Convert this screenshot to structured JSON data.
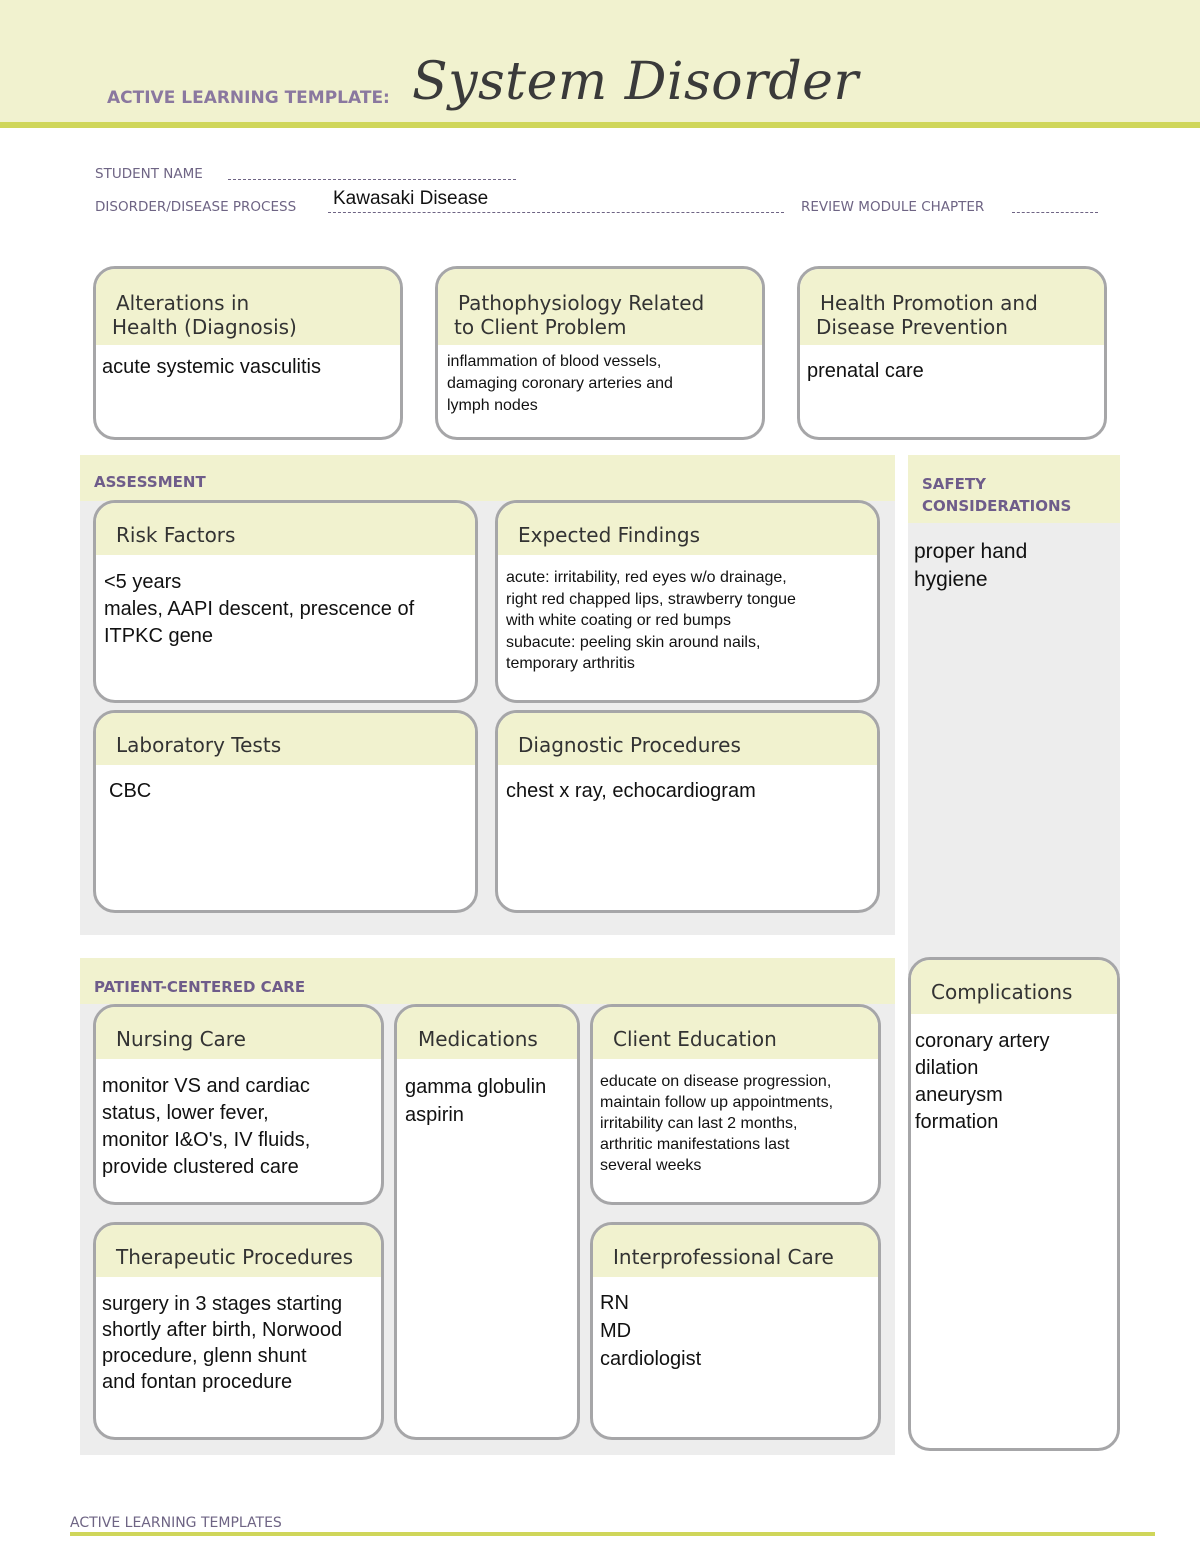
{
  "header": {
    "template_label": "ACTIVE LEARNING TEMPLATE:",
    "title": "System Disorder"
  },
  "meta": {
    "student_name_label": "STUDENT NAME",
    "student_name_value": "",
    "disorder_label": "DISORDER/DISEASE PROCESS",
    "disorder_value": "Kawasaki Disease",
    "review_module_label": "REVIEW MODULE CHAPTER",
    "review_module_value": ""
  },
  "top_cards": {
    "alterations": {
      "title_line1": "Alterations in",
      "title_line2": "Health (Diagnosis)",
      "lines": [
        "acute systemic vasculitis"
      ]
    },
    "pathophysiology": {
      "title_line1": "Pathophysiology Related",
      "title_line2": "to Client Problem",
      "lines": [
        "inflammation of blood vessels,",
        "damaging coronary arteries and",
        "lymph nodes"
      ]
    },
    "health_promotion": {
      "title_line1": "Health Promotion and",
      "title_line2": "Disease Prevention",
      "lines": [
        "prenatal care"
      ]
    }
  },
  "assessment": {
    "section_label": "ASSESSMENT",
    "risk_factors": {
      "title": "Risk Factors",
      "lines": [
        "<5 years",
        "males, AAPI descent, prescence of",
        "ITPKC gene"
      ]
    },
    "expected_findings": {
      "title": "Expected Findings",
      "lines": [
        "acute: irritability, red eyes w/o drainage,",
        "right red chapped lips, strawberry tongue",
        "with white coating or red bumps",
        "subacute: peeling skin around nails,",
        "temporary arthritis"
      ]
    },
    "laboratory_tests": {
      "title": "Laboratory Tests",
      "lines": [
        "CBC"
      ]
    },
    "diagnostic_procedures": {
      "title": "Diagnostic Procedures",
      "lines": [
        "chest x ray, echocardiogram"
      ]
    }
  },
  "safety": {
    "section_label_line1": "SAFETY",
    "section_label_line2": "CONSIDERATIONS",
    "lines": [
      "proper hand",
      "hygiene"
    ]
  },
  "patient_centered_care": {
    "section_label": "PATIENT-CENTERED CARE",
    "nursing_care": {
      "title": "Nursing Care",
      "lines": [
        "monitor VS and cardiac",
        "status, lower fever,",
        "monitor I&O's, IV fluids,",
        "provide clustered care"
      ]
    },
    "medications": {
      "title": "Medications",
      "lines": [
        "gamma globulin",
        "aspirin"
      ]
    },
    "client_education": {
      "title": "Client Education",
      "lines": [
        "educate on disease progression,",
        "maintain follow up appointments,",
        "irritability can last 2 months,",
        "arthritic manifestations last",
        "several weeks"
      ]
    },
    "therapeutic_procedures": {
      "title": "Therapeutic Procedures",
      "lines": [
        "surgery in 3 stages starting",
        "shortly after birth, Norwood",
        "procedure, glenn shunt",
        "and fontan procedure"
      ]
    },
    "interprofessional_care": {
      "title": "Interprofessional Care",
      "lines": [
        "RN",
        "MD",
        "cardiologist"
      ]
    }
  },
  "complications": {
    "title": "Complications",
    "lines": [
      "coronary artery",
      "dilation",
      "aneurysm",
      "formation"
    ]
  },
  "footer": {
    "label": "ACTIVE LEARNING TEMPLATES"
  },
  "colors": {
    "header_band": "#f1f2cf",
    "accent_rule": "#cfd65a",
    "section_label": "#6e5c8a",
    "card_border": "#a6a6a8",
    "section_background": "#ededed"
  }
}
